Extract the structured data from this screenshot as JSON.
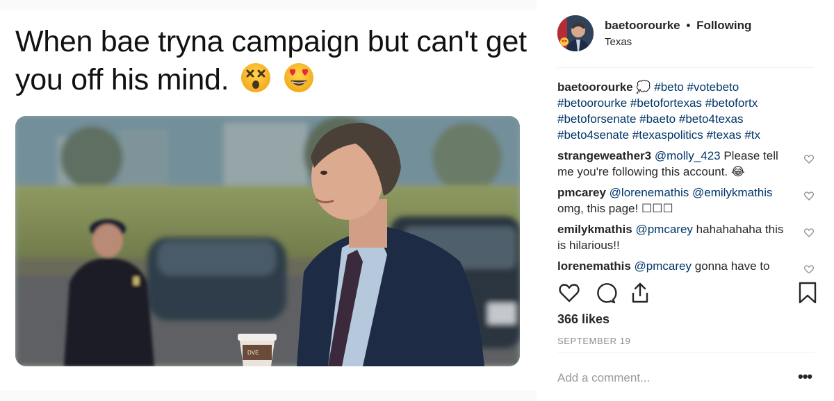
{
  "post": {
    "caption_title": "When bae tryna campaign but can't get you off his mind.",
    "emojis": [
      "dizzy-face-emoji",
      "heart-eyes-emoji"
    ]
  },
  "header": {
    "username": "baetoorourke",
    "separator": "•",
    "follow_status": "Following",
    "location": "Texas"
  },
  "comments": [
    {
      "user": "baetoorourke",
      "text": "💭 #beto #votebeto #betoorourke #betofortexas #betofortx #betoforsenate #baeto #beto4texas #beto4senate #texaspolitics #texas #tx",
      "liked": false,
      "show_heart": false
    },
    {
      "user": "strangeweather3",
      "mention": "@molly_423",
      "text": "Please tell me you're following this account. 😂",
      "show_heart": true
    },
    {
      "user": "pmcarey",
      "mention": "@lorenemathis @emilykmathis",
      "text": "omg, this page! ☐☐☐",
      "show_heart": true
    },
    {
      "user": "emilykmathis",
      "mention": "@pmcarey",
      "text": "hahahahaha this is hilarious!!",
      "show_heart": true
    },
    {
      "user": "lorenemathis",
      "mention": "@pmcarey",
      "text": "gonna have to",
      "show_heart": true
    }
  ],
  "actions": {
    "icons": [
      "heart-icon",
      "comment-icon",
      "share-icon",
      "bookmark-icon"
    ]
  },
  "likes": "366 likes",
  "date": "SEPTEMBER 19",
  "add_comment": {
    "placeholder": "Add a comment..."
  },
  "more_options": "•••",
  "colors": {
    "text": "#262626",
    "hashtag": "#003569",
    "muted": "#8e8e8e",
    "border": "#efefef"
  }
}
